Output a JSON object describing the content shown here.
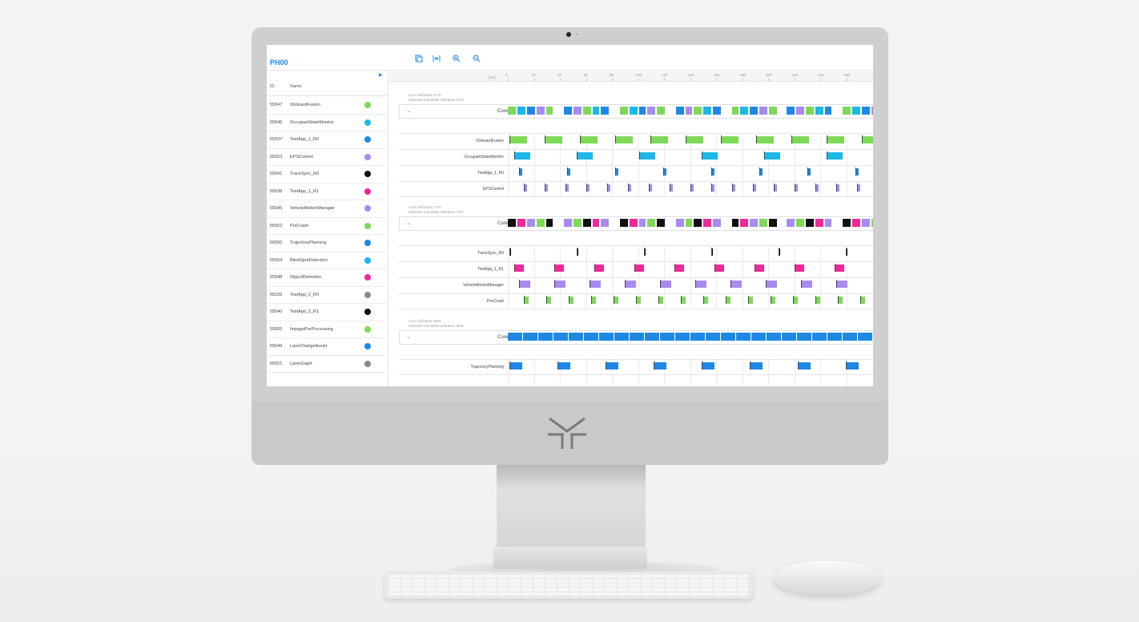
{
  "app": {
    "title": "PH00"
  },
  "toolbar": {
    "icons": [
      "export-icon",
      "fit-width-icon",
      "zoom-in-icon",
      "zoom-out-icon"
    ]
  },
  "list": {
    "headers": {
      "id": "ID",
      "name": "Name"
    },
    "rows": [
      {
        "id": "55547",
        "name": "OnboardFusion",
        "color": "#7ed957"
      },
      {
        "id": "55546",
        "name": "OccupantStateMonitor",
        "color": "#1cb8e8"
      },
      {
        "id": "55537",
        "name": "TestApp_1_R0",
        "color": "#1e88e5"
      },
      {
        "id": "55553",
        "name": "EPSControl",
        "color": "#a78bf0"
      },
      {
        "id": "55541",
        "name": "TraceSync_R0",
        "color": "#111111"
      },
      {
        "id": "55538",
        "name": "TestApp_1_R1",
        "color": "#f0289a"
      },
      {
        "id": "55545",
        "name": "VehicleMotionManager",
        "color": "#a78bf0"
      },
      {
        "id": "55552",
        "name": "PreCrash",
        "color": "#7ed957"
      },
      {
        "id": "55550",
        "name": "TrajectoryPlanning",
        "color": "#1e88e5"
      },
      {
        "id": "55554",
        "name": "BlindSpotDetection",
        "color": "#1cb8e8"
      },
      {
        "id": "55548",
        "name": "ObjectDetection",
        "color": "#f0289a"
      },
      {
        "id": "55539",
        "name": "TestApp_2_R0",
        "color": "#8a8a8a"
      },
      {
        "id": "55540",
        "name": "TestApp_2_R1",
        "color": "#111111"
      },
      {
        "id": "55555",
        "name": "ImpapsPreProcessing",
        "color": "#7ed957"
      },
      {
        "id": "55549",
        "name": "LaneChangeAssist",
        "color": "#1e88e5"
      },
      {
        "id": "55551",
        "name": "LaneGraph",
        "color": "#8a8a8a"
      }
    ]
  },
  "timeline": {
    "unit": "[ms]",
    "ticks": [
      "0",
      "20",
      "40",
      "60",
      "80",
      "100",
      "120",
      "140",
      "160",
      "180",
      "200",
      "220",
      "240",
      "260"
    ],
    "cores": [
      {
        "label": "Core 0",
        "util": "Core Utilization 67%",
        "sel_util": "Selected runnables utilization 67%",
        "tasks": [
          {
            "label": "OnboardFusion",
            "color": "#7ed957"
          },
          {
            "label": "OccupantStateMonitor",
            "color": "#1cb8e8"
          },
          {
            "label": "TestApp_1_R0",
            "color": "#1e88e5"
          },
          {
            "label": "EPSControl",
            "color": "#a78bf0"
          }
        ]
      },
      {
        "label": "Core 1",
        "util": "Core Utilization 77%",
        "sel_util": "Selected runnables utilization 77%",
        "tasks": [
          {
            "label": "TraceSync_R0",
            "color": "#111111"
          },
          {
            "label": "TestApp_1_R1",
            "color": "#f0289a"
          },
          {
            "label": "VehicleMotionManager",
            "color": "#a78bf0"
          },
          {
            "label": "PreCrash",
            "color": "#7ed957"
          }
        ]
      },
      {
        "label": "Core 2",
        "util": "Core Utilization 86%",
        "sel_util": "Selected runnables utilization 86%",
        "tasks": [
          {
            "label": "TrajectoryPlanning",
            "color": "#1e88e5"
          }
        ]
      }
    ]
  }
}
